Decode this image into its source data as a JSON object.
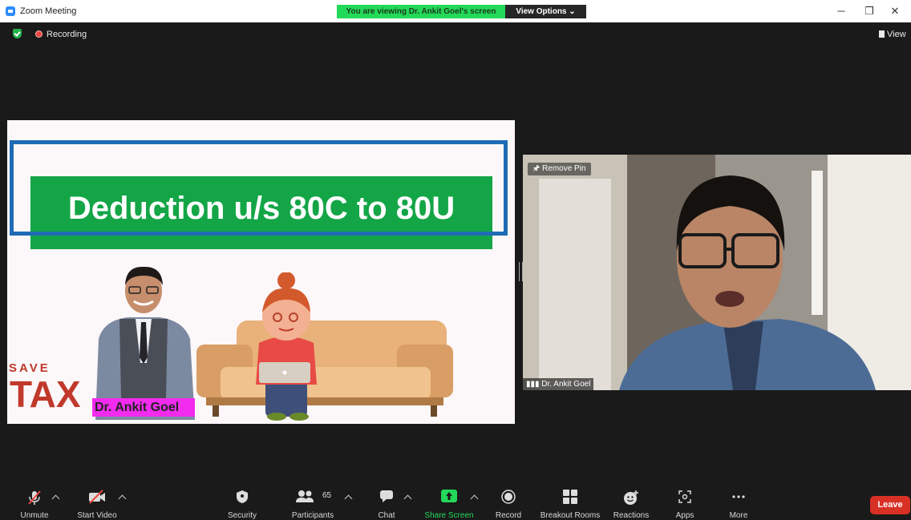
{
  "window": {
    "title": "Zoom Meeting",
    "viewing_banner": "You are viewing Dr. Ankit Goel's screen",
    "view_options": "View Options ⌄",
    "minimize": "─",
    "restore": "❐",
    "close": "✕"
  },
  "status": {
    "recording_label": "Recording",
    "view_label": "View"
  },
  "shared_slide": {
    "title": "Deduction u/s 80C to 80U",
    "presenter_name": "Dr. Ankit Goel",
    "badge_save": "SAVE",
    "badge_tax": "TAX"
  },
  "video_tile": {
    "remove_pin_label": "Remove Pin",
    "participant_name": "Dr. Ankit Goel"
  },
  "toolbar": {
    "unmute": "Unmute",
    "start_video": "Start Video",
    "security": "Security",
    "participants": "Participants",
    "participant_count": "65",
    "chat": "Chat",
    "share_screen": "Share Screen",
    "record": "Record",
    "breakout_rooms": "Breakout Rooms",
    "reactions": "Reactions",
    "apps": "Apps",
    "more": "More",
    "leave": "Leave"
  },
  "colors": {
    "share_green": "#23d959",
    "leave_red": "#d93025",
    "slide_title_green": "#14a547",
    "slide_frame_blue": "#1f6bb5",
    "name_label_magenta": "#f22bef"
  }
}
